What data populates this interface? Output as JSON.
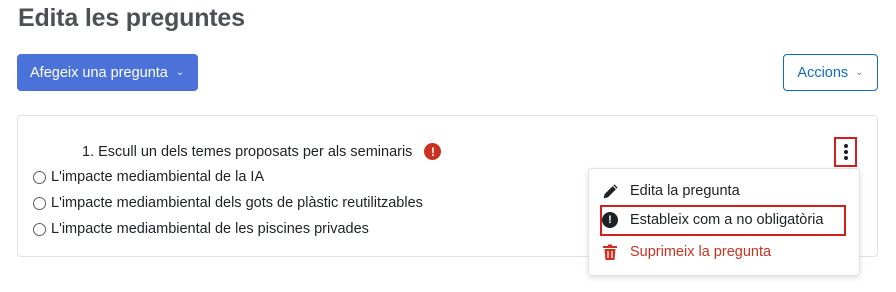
{
  "page": {
    "title": "Edita les preguntes"
  },
  "toolbar": {
    "add_label": "Afegeix una pregunta",
    "actions_label": "Accions"
  },
  "question": {
    "title": "1. Escull un dels temes proposats per als seminaris",
    "options": [
      "L'impacte mediambiental de la IA",
      "L'impacte mediambiental dels gots de plàstic reutilitzables",
      "L'impacte mediambiental de les piscines privades"
    ]
  },
  "menu": {
    "edit_label": "Edita la pregunta",
    "optional_label": "Estableix com a no obligatòria",
    "delete_label": "Suprimeix la pregunta"
  },
  "colors": {
    "primary": "#4a72d8",
    "danger": "#ca3120",
    "highlight": "#d0201e"
  },
  "icons": {
    "required": "exclamation-circle-icon",
    "edit": "pencil-icon",
    "optional": "exclamation-circle-icon",
    "delete": "trash-icon",
    "more": "kebab-menu-icon"
  }
}
